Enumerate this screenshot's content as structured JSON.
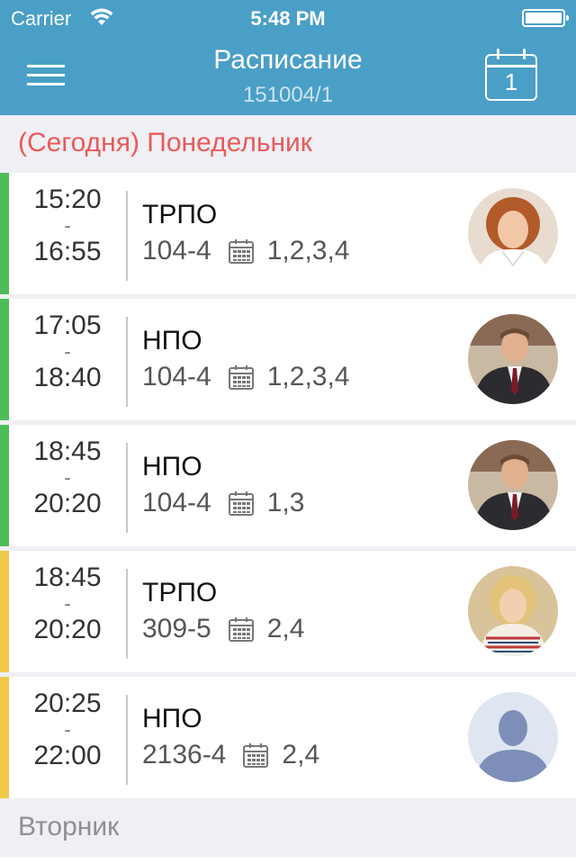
{
  "status_bar": {
    "carrier": "Carrier",
    "time": "5:48 PM"
  },
  "nav": {
    "title": "Расписание",
    "subtitle": "151004/1",
    "calendar_day": "1"
  },
  "sections": {
    "today": "(Сегодня)  Понедельник",
    "next": "Вторник"
  },
  "lessons": [
    {
      "start": "15:20",
      "sep": "-",
      "end": "16:55",
      "subject": "ТРПО",
      "room": "104-4",
      "weeks": "1,2,3,4",
      "stripe": "#4fbc5a",
      "avatar": "woman-redhead"
    },
    {
      "start": "17:05",
      "sep": "-",
      "end": "18:40",
      "subject": "НПО",
      "room": "104-4",
      "weeks": "1,2,3,4",
      "stripe": "#4fbc5a",
      "avatar": "man-suit"
    },
    {
      "start": "18:45",
      "sep": "-",
      "end": "20:20",
      "subject": "НПО",
      "room": "104-4",
      "weeks": "1,3",
      "stripe": "#4fbc5a",
      "avatar": "man-suit"
    },
    {
      "start": "18:45",
      "sep": "-",
      "end": "20:20",
      "subject": "ТРПО",
      "room": "309-5",
      "weeks": "2,4",
      "stripe": "#f0c94a",
      "avatar": "woman-blonde"
    },
    {
      "start": "20:25",
      "sep": "-",
      "end": "22:00",
      "subject": "НПО",
      "room": "2136-4",
      "weeks": "2,4",
      "stripe": "#f0c94a",
      "avatar": "placeholder"
    }
  ],
  "colors": {
    "header": "#4a9fc7",
    "today": "#e85a5a",
    "green": "#4fbc5a",
    "yellow": "#f0c94a"
  }
}
